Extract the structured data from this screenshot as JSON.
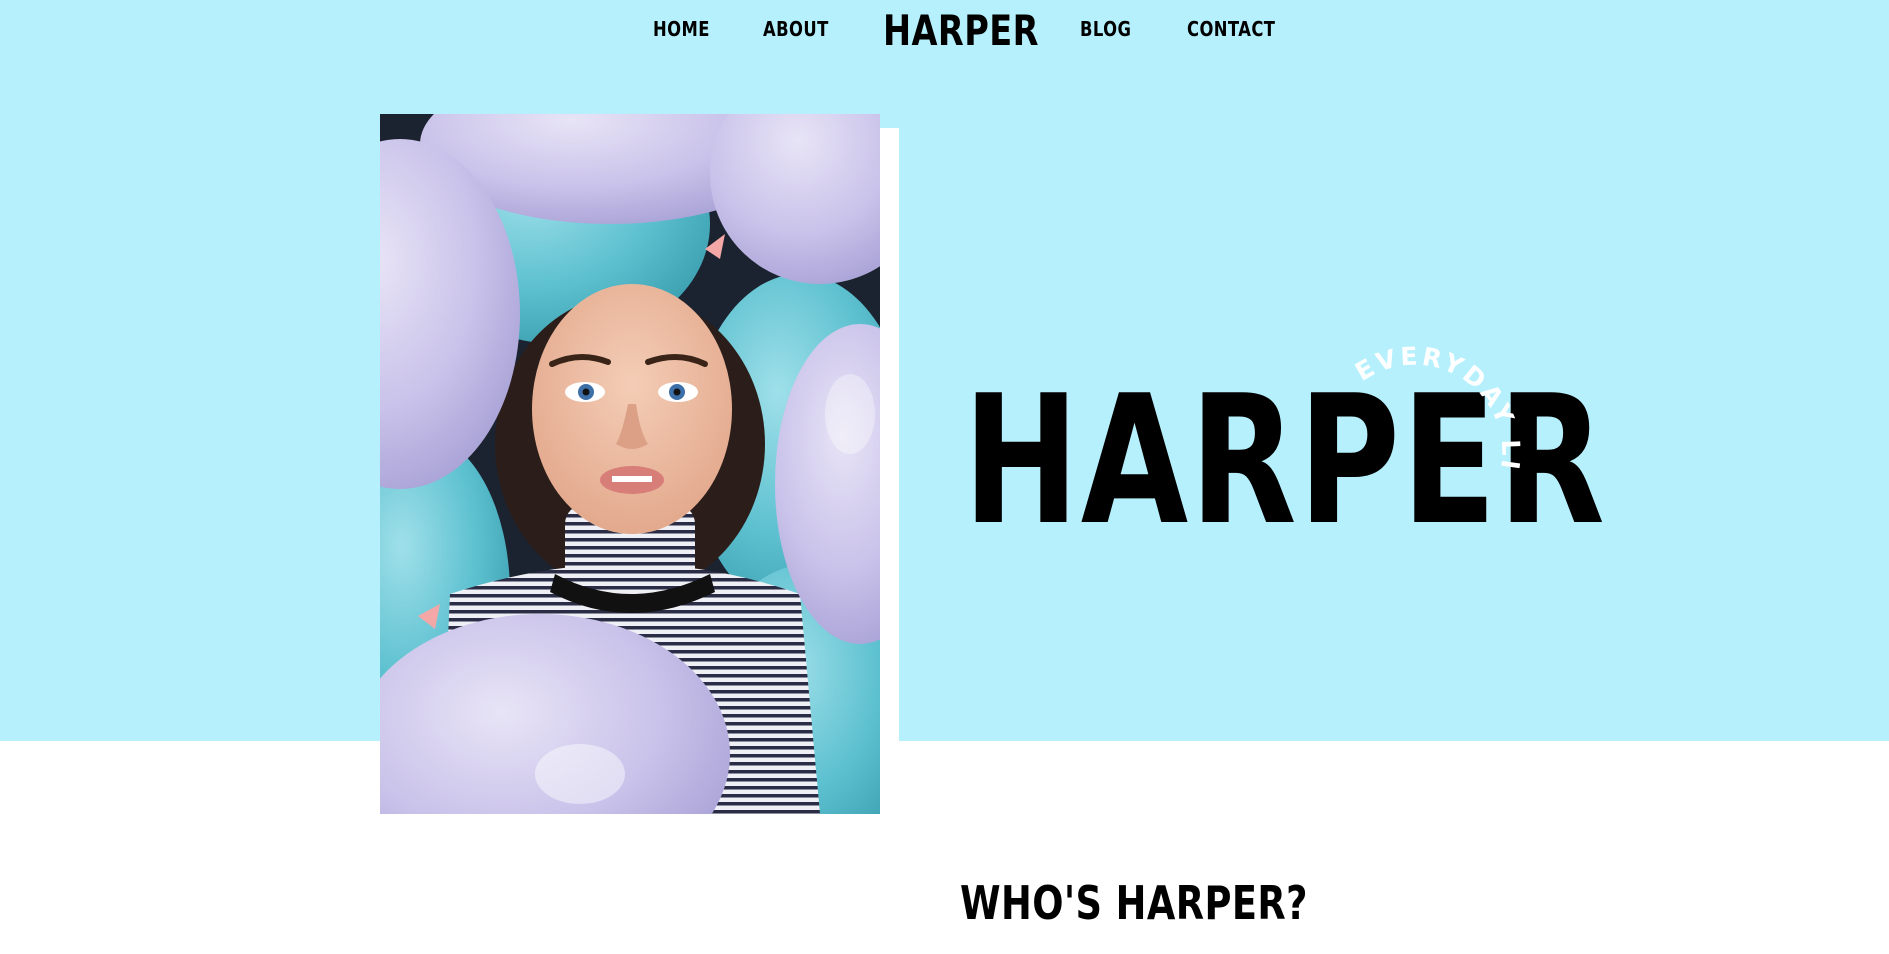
{
  "nav": {
    "items": [
      {
        "label": "HOME"
      },
      {
        "label": "ABOUT"
      },
      {
        "label": "BLOG"
      },
      {
        "label": "CONTACT"
      }
    ],
    "brand": "HARPER"
  },
  "hero": {
    "title": "HARPER",
    "arc_tagline": "EVERYDAY LIFE WITH",
    "background_color": "#b6f0fd",
    "photo_subject": "girl-in-balloons-photo"
  },
  "about": {
    "heading": "WHO'S HARPER?"
  }
}
